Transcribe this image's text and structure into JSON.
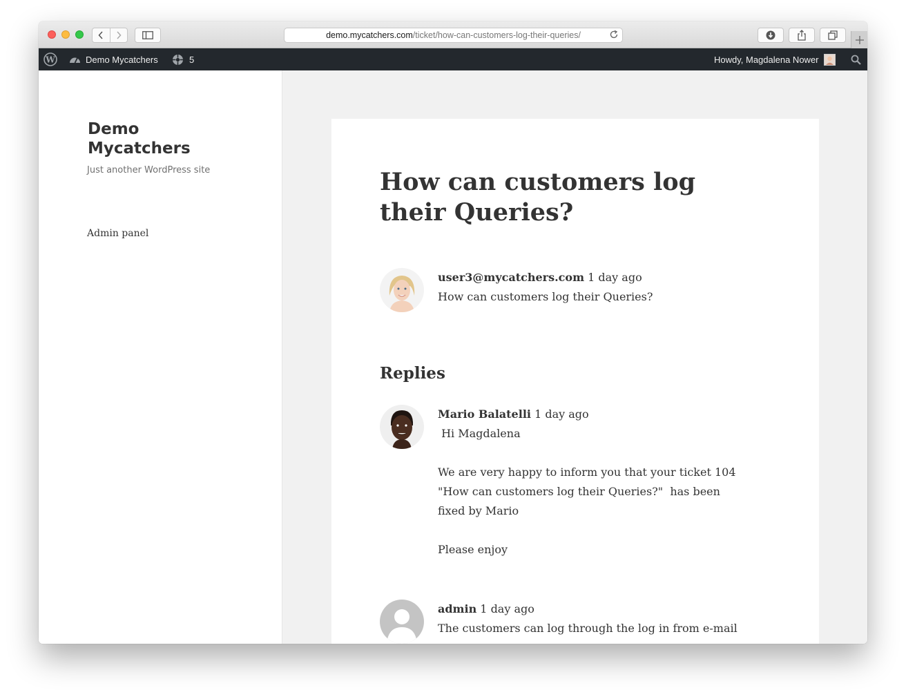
{
  "browser": {
    "url_host": "demo.mycatchers.com",
    "url_path": "/ticket/how-can-customers-log-their-queries/"
  },
  "admin_bar": {
    "site_name": "Demo Mycatchers",
    "updates_count": "5",
    "howdy": "Howdy, Magdalena Nower"
  },
  "sidebar": {
    "site_title": "Demo Mycatchers",
    "tagline": "Just another WordPress site",
    "admin_link": "Admin panel"
  },
  "ticket": {
    "title": "How can customers log their Queries?",
    "author": "user3@mycatchers.com",
    "time": "1 day ago",
    "message": "How can customers log their Queries?"
  },
  "replies": {
    "heading": "Replies",
    "items": [
      {
        "author": "Mario Balatelli",
        "time": "1 day ago",
        "lines": [
          " Hi Magdalena",
          "We are very happy to inform you that your ticket 104  \"How can customers log their Queries?\"  has been fixed by Mario",
          "Please enjoy"
        ]
      },
      {
        "author": "admin",
        "time": "1 day ago",
        "lines": [
          "The customers can log through the log in from e-mail"
        ]
      }
    ]
  },
  "colors": {
    "admin_bar_bg": "#23282d",
    "page_bg": "#f1f1f1",
    "text": "#333333"
  }
}
